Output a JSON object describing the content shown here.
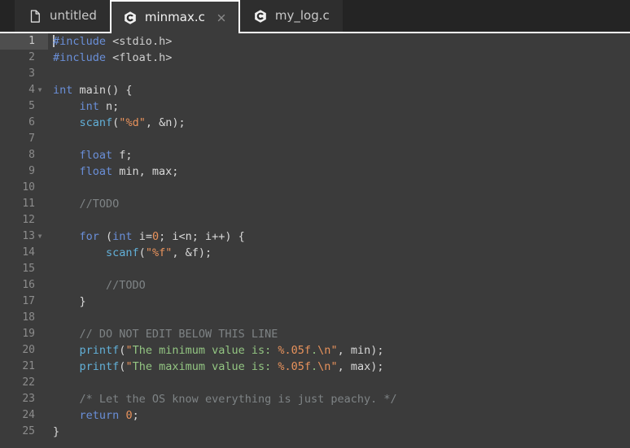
{
  "window": {
    "background": "#3b3b3b",
    "tabbar_background": "#242424"
  },
  "tabbar": {
    "tabs": [
      {
        "label": "untitled",
        "icon": "file-icon",
        "active": false,
        "closable": false
      },
      {
        "label": "minmax.c",
        "icon": "c-language-icon",
        "active": true,
        "closable": true,
        "close_label": "×"
      },
      {
        "label": "my_log.c",
        "icon": "c-language-icon",
        "active": false,
        "closable": false
      }
    ]
  },
  "editor": {
    "filename": "minmax.c",
    "language": "C",
    "active_line": 1,
    "total_lines": 25,
    "cursor": {
      "line": 1,
      "column": 1
    },
    "colors": {
      "background": "#3b3b3b",
      "gutter_text": "#8c8c8c",
      "active_line_gutter": "#4e4e4e",
      "keyword": "#6a8fd8",
      "preprocessor": "#6a8fd8",
      "function": "#62b0d8",
      "string": "#93c582",
      "escape": "#e8925c",
      "number": "#e8925c",
      "comment": "#7e8385",
      "plain": "#d8d8d8"
    },
    "lines": [
      {
        "n": 1,
        "fold": false,
        "text": "#include <stdio.h>"
      },
      {
        "n": 2,
        "fold": false,
        "text": "#include <float.h>"
      },
      {
        "n": 3,
        "fold": false,
        "text": ""
      },
      {
        "n": 4,
        "fold": true,
        "text": "int main() {"
      },
      {
        "n": 5,
        "fold": false,
        "text": "    int n;"
      },
      {
        "n": 6,
        "fold": false,
        "text": "    scanf(\"%d\", &n);"
      },
      {
        "n": 7,
        "fold": false,
        "text": ""
      },
      {
        "n": 8,
        "fold": false,
        "text": "    float f;"
      },
      {
        "n": 9,
        "fold": false,
        "text": "    float min, max;"
      },
      {
        "n": 10,
        "fold": false,
        "text": ""
      },
      {
        "n": 11,
        "fold": false,
        "text": "    //TODO"
      },
      {
        "n": 12,
        "fold": false,
        "text": ""
      },
      {
        "n": 13,
        "fold": true,
        "text": "    for (int i=0; i<n; i++) {"
      },
      {
        "n": 14,
        "fold": false,
        "text": "        scanf(\"%f\", &f);"
      },
      {
        "n": 15,
        "fold": false,
        "text": ""
      },
      {
        "n": 16,
        "fold": false,
        "text": "        //TODO"
      },
      {
        "n": 17,
        "fold": false,
        "text": "    }"
      },
      {
        "n": 18,
        "fold": false,
        "text": ""
      },
      {
        "n": 19,
        "fold": false,
        "text": "    // DO NOT EDIT BELOW THIS LINE"
      },
      {
        "n": 20,
        "fold": false,
        "text": "    printf(\"The minimum value is: %.05f.\\n\", min);"
      },
      {
        "n": 21,
        "fold": false,
        "text": "    printf(\"The maximum value is: %.05f.\\n\", max);"
      },
      {
        "n": 22,
        "fold": false,
        "text": ""
      },
      {
        "n": 23,
        "fold": false,
        "text": "    /* Let the OS know everything is just peachy. */"
      },
      {
        "n": 24,
        "fold": false,
        "text": "    return 0;"
      },
      {
        "n": 25,
        "fold": false,
        "text": "}"
      }
    ],
    "tokens": [
      [
        {
          "c": "pre",
          "t": "#include"
        },
        {
          "c": "plain",
          "t": " "
        },
        {
          "c": "inc",
          "t": "<stdio.h>"
        }
      ],
      [
        {
          "c": "pre",
          "t": "#include"
        },
        {
          "c": "plain",
          "t": " "
        },
        {
          "c": "inc",
          "t": "<float.h>"
        }
      ],
      [],
      [
        {
          "c": "kw",
          "t": "int"
        },
        {
          "c": "plain",
          "t": " main() {"
        }
      ],
      [
        {
          "c": "plain",
          "t": "    "
        },
        {
          "c": "kw",
          "t": "int"
        },
        {
          "c": "plain",
          "t": " n;"
        }
      ],
      [
        {
          "c": "plain",
          "t": "    "
        },
        {
          "c": "fn",
          "t": "scanf"
        },
        {
          "c": "plain",
          "t": "("
        },
        {
          "c": "esc",
          "t": "\""
        },
        {
          "c": "esc",
          "t": "%d"
        },
        {
          "c": "esc",
          "t": "\""
        },
        {
          "c": "plain",
          "t": ", &n);"
        }
      ],
      [],
      [
        {
          "c": "plain",
          "t": "    "
        },
        {
          "c": "kw",
          "t": "float"
        },
        {
          "c": "plain",
          "t": " f;"
        }
      ],
      [
        {
          "c": "plain",
          "t": "    "
        },
        {
          "c": "kw",
          "t": "float"
        },
        {
          "c": "plain",
          "t": " min, max;"
        }
      ],
      [],
      [
        {
          "c": "plain",
          "t": "    "
        },
        {
          "c": "cmt",
          "t": "//TODO"
        }
      ],
      [],
      [
        {
          "c": "plain",
          "t": "    "
        },
        {
          "c": "kw",
          "t": "for"
        },
        {
          "c": "plain",
          "t": " ("
        },
        {
          "c": "kw",
          "t": "int"
        },
        {
          "c": "plain",
          "t": " i="
        },
        {
          "c": "num",
          "t": "0"
        },
        {
          "c": "plain",
          "t": "; i<n; i++) {"
        }
      ],
      [
        {
          "c": "plain",
          "t": "        "
        },
        {
          "c": "fn",
          "t": "scanf"
        },
        {
          "c": "plain",
          "t": "("
        },
        {
          "c": "esc",
          "t": "\""
        },
        {
          "c": "esc",
          "t": "%f"
        },
        {
          "c": "esc",
          "t": "\""
        },
        {
          "c": "plain",
          "t": ", &f);"
        }
      ],
      [],
      [
        {
          "c": "plain",
          "t": "        "
        },
        {
          "c": "cmt",
          "t": "//TODO"
        }
      ],
      [
        {
          "c": "plain",
          "t": "    }"
        }
      ],
      [],
      [
        {
          "c": "plain",
          "t": "    "
        },
        {
          "c": "cmt",
          "t": "// DO NOT EDIT BELOW THIS LINE"
        }
      ],
      [
        {
          "c": "plain",
          "t": "    "
        },
        {
          "c": "fn",
          "t": "printf"
        },
        {
          "c": "plain",
          "t": "("
        },
        {
          "c": "esc",
          "t": "\""
        },
        {
          "c": "str",
          "t": "The minimum value is: "
        },
        {
          "c": "esc",
          "t": "%.05f"
        },
        {
          "c": "str",
          "t": "."
        },
        {
          "c": "esc",
          "t": "\\n"
        },
        {
          "c": "esc",
          "t": "\""
        },
        {
          "c": "plain",
          "t": ", min);"
        }
      ],
      [
        {
          "c": "plain",
          "t": "    "
        },
        {
          "c": "fn",
          "t": "printf"
        },
        {
          "c": "plain",
          "t": "("
        },
        {
          "c": "esc",
          "t": "\""
        },
        {
          "c": "str",
          "t": "The maximum value is: "
        },
        {
          "c": "esc",
          "t": "%.05f"
        },
        {
          "c": "str",
          "t": "."
        },
        {
          "c": "esc",
          "t": "\\n"
        },
        {
          "c": "esc",
          "t": "\""
        },
        {
          "c": "plain",
          "t": ", max);"
        }
      ],
      [],
      [
        {
          "c": "plain",
          "t": "    "
        },
        {
          "c": "cmt",
          "t": "/* Let the OS know everything is just peachy. */"
        }
      ],
      [
        {
          "c": "plain",
          "t": "    "
        },
        {
          "c": "kw",
          "t": "return"
        },
        {
          "c": "plain",
          "t": " "
        },
        {
          "c": "num",
          "t": "0"
        },
        {
          "c": "plain",
          "t": ";"
        }
      ],
      [
        {
          "c": "plain",
          "t": "}"
        }
      ]
    ]
  }
}
